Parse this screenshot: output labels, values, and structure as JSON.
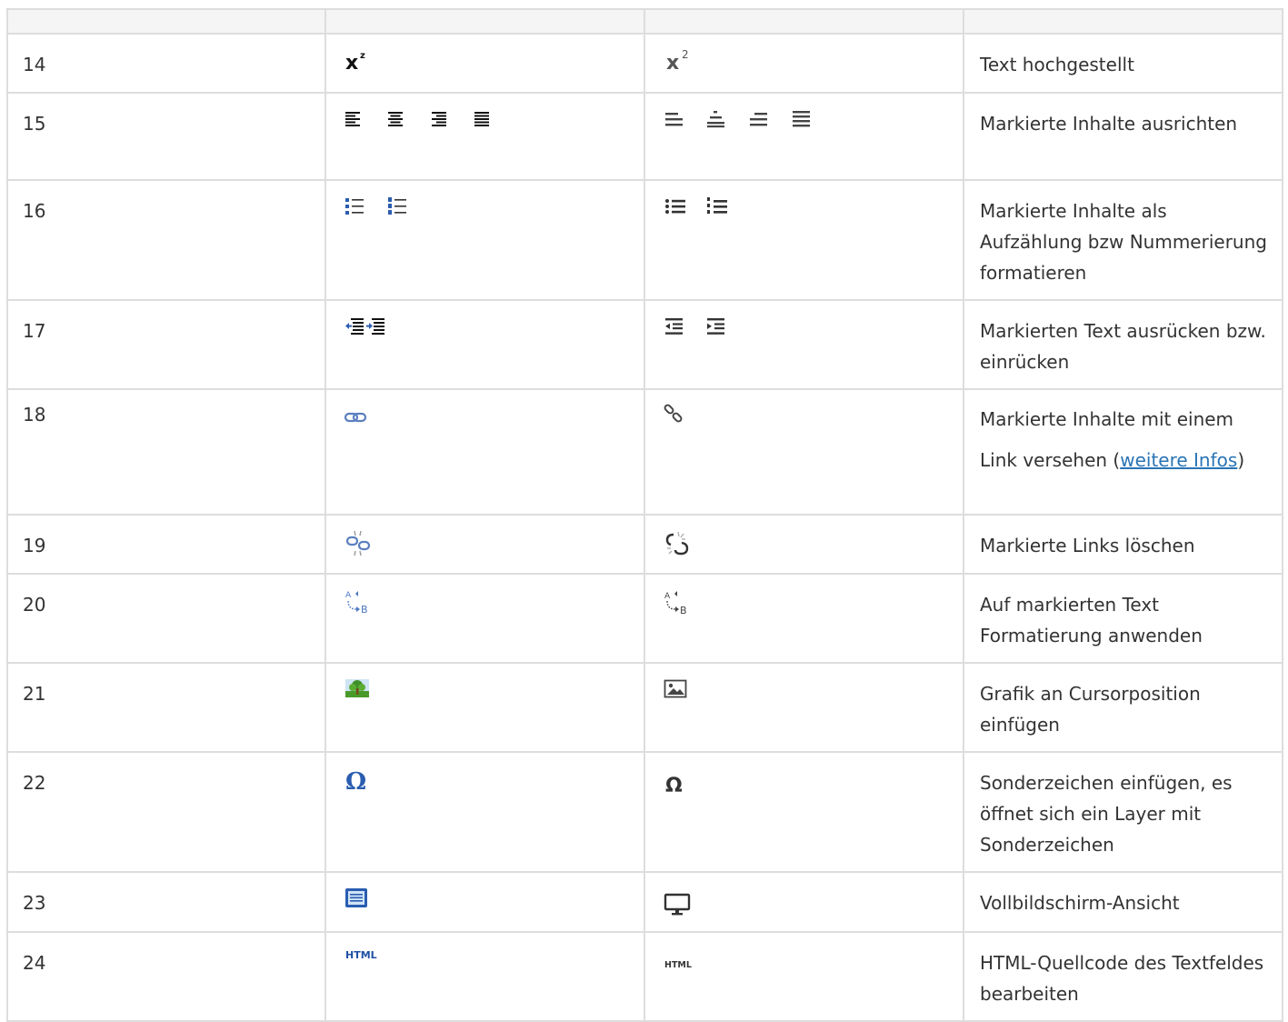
{
  "table": {
    "header": [
      "",
      "",
      "",
      ""
    ],
    "rows": [
      {
        "num": "14",
        "old_icons": [
          "superscript-icon"
        ],
        "new_icons": [
          "superscript-icon"
        ],
        "desc": "Text hochgestellt"
      },
      {
        "num": "15",
        "old_icons": [
          "align-left-icon",
          "align-center-icon",
          "align-right-icon",
          "align-justify-icon"
        ],
        "new_icons": [
          "align-left-icon",
          "align-center-icon",
          "align-right-icon",
          "align-justify-icon"
        ],
        "desc": "Markierte Inhalte ausrichten"
      },
      {
        "num": "16",
        "old_icons": [
          "bulleted-list-icon",
          "numbered-list-icon"
        ],
        "new_icons": [
          "bulleted-list-icon",
          "numbered-list-icon"
        ],
        "desc": "Markierte Inhalte als Aufzählung bzw Nummerierung formatieren"
      },
      {
        "num": "17",
        "old_icons": [
          "outdent-icon",
          "indent-icon"
        ],
        "new_icons": [
          "outdent-icon",
          "indent-icon"
        ],
        "desc": "Markierten Text ausrücken bzw. einrücken"
      },
      {
        "num": "18",
        "old_icons": [
          "link-icon"
        ],
        "new_icons": [
          "link-icon"
        ],
        "desc_before": "Markierte Inhalte mit einem Link versehen (",
        "desc_link": "weitere Infos",
        "desc_after": ")"
      },
      {
        "num": "19",
        "old_icons": [
          "unlink-icon"
        ],
        "new_icons": [
          "unlink-icon"
        ],
        "desc": "Markierte Links löschen"
      },
      {
        "num": "20",
        "old_icons": [
          "apply-style-icon"
        ],
        "new_icons": [
          "apply-style-icon"
        ],
        "desc": "Auf markierten Text Formatierung anwenden"
      },
      {
        "num": "21",
        "old_icons": [
          "image-icon"
        ],
        "new_icons": [
          "image-icon"
        ],
        "desc": "Grafik an Cursorposition einfügen"
      },
      {
        "num": "22",
        "old_icons": [
          "omega-icon"
        ],
        "new_icons": [
          "omega-icon"
        ],
        "desc": "Sonderzeichen einfügen, es öffnet sich ein Layer mit Sonderzeichen"
      },
      {
        "num": "23",
        "old_icons": [
          "fullscreen-icon"
        ],
        "new_icons": [
          "monitor-icon"
        ],
        "desc": "Vollbildschirm-Ansicht"
      },
      {
        "num": "24",
        "old_icons": [
          "html-source-icon"
        ],
        "new_icons": [
          "html-source-icon"
        ],
        "desc": "HTML-Quellcode des Textfeldes bearbeiten"
      }
    ],
    "icon_text": {
      "superscript_base": "x",
      "superscript_exp": "2",
      "superscript_exp_old": "z",
      "omega": "Ω",
      "html_old": "HTML",
      "html_new": "HTML",
      "style_a": "A",
      "style_b": "B"
    }
  },
  "colors": {
    "border": "#dddddd",
    "header_bg": "#f5f5f5",
    "text": "#333333",
    "link": "#2a74b5",
    "old_icon_blue": "#1f4fa3",
    "new_icon_gray": "#444444"
  }
}
